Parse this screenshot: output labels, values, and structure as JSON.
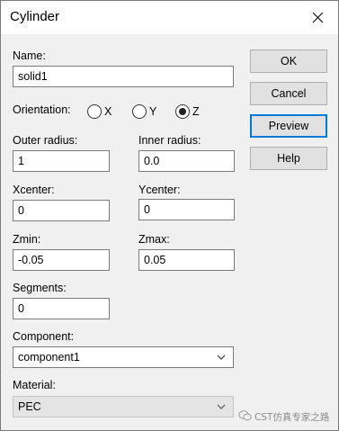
{
  "window": {
    "title": "Cylinder"
  },
  "fields": {
    "name": {
      "label": "Name:",
      "value": "solid1"
    },
    "orientation": {
      "label": "Orientation:",
      "options": [
        "X",
        "Y",
        "Z"
      ],
      "selected": "Z"
    },
    "outer_radius": {
      "label": "Outer radius:",
      "value": "1"
    },
    "inner_radius": {
      "label": "Inner radius:",
      "value": "0.0"
    },
    "xcenter": {
      "label": "Xcenter:",
      "value": "0"
    },
    "ycenter": {
      "label": "Ycenter:",
      "value": "0"
    },
    "zmin": {
      "label": "Zmin:",
      "value": "-0.05"
    },
    "zmax": {
      "label": "Zmax:",
      "value": "0.05"
    },
    "segments": {
      "label": "Segments:",
      "value": "0"
    },
    "component": {
      "label": "Component:",
      "value": "component1"
    },
    "material": {
      "label": "Material:",
      "value": "PEC"
    }
  },
  "buttons": {
    "ok": "OK",
    "cancel": "Cancel",
    "preview": "Preview",
    "help": "Help"
  },
  "watermark": {
    "text": "CST仿真专家之路"
  },
  "colors": {
    "focus_border": "#0078d7",
    "button_bg": "#e1e1e1",
    "disabled_bg": "#e4e4e4"
  },
  "icons": {
    "close": "close-icon",
    "dropdown": "chevron-down-icon",
    "watermark": "wechat-icon"
  }
}
